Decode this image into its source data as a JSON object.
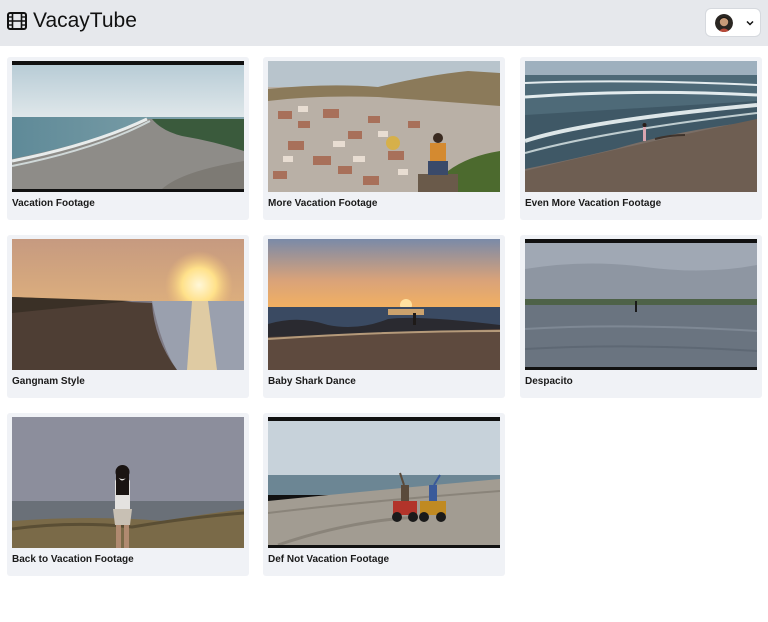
{
  "app": {
    "name": "VacayTube"
  },
  "header": {
    "logo_icon": "film-icon",
    "user_menu": {
      "avatar_icon": "user-avatar",
      "dropdown_icon": "chevron-down-icon"
    }
  },
  "videos": [
    {
      "title": "Vacation Footage"
    },
    {
      "title": "More Vacation Footage"
    },
    {
      "title": "Even More Vacation Footage"
    },
    {
      "title": "Gangnam Style"
    },
    {
      "title": "Baby Shark Dance"
    },
    {
      "title": "Despacito"
    },
    {
      "title": "Back to Vacation Footage"
    },
    {
      "title": "Def Not Vacation Footage"
    }
  ]
}
